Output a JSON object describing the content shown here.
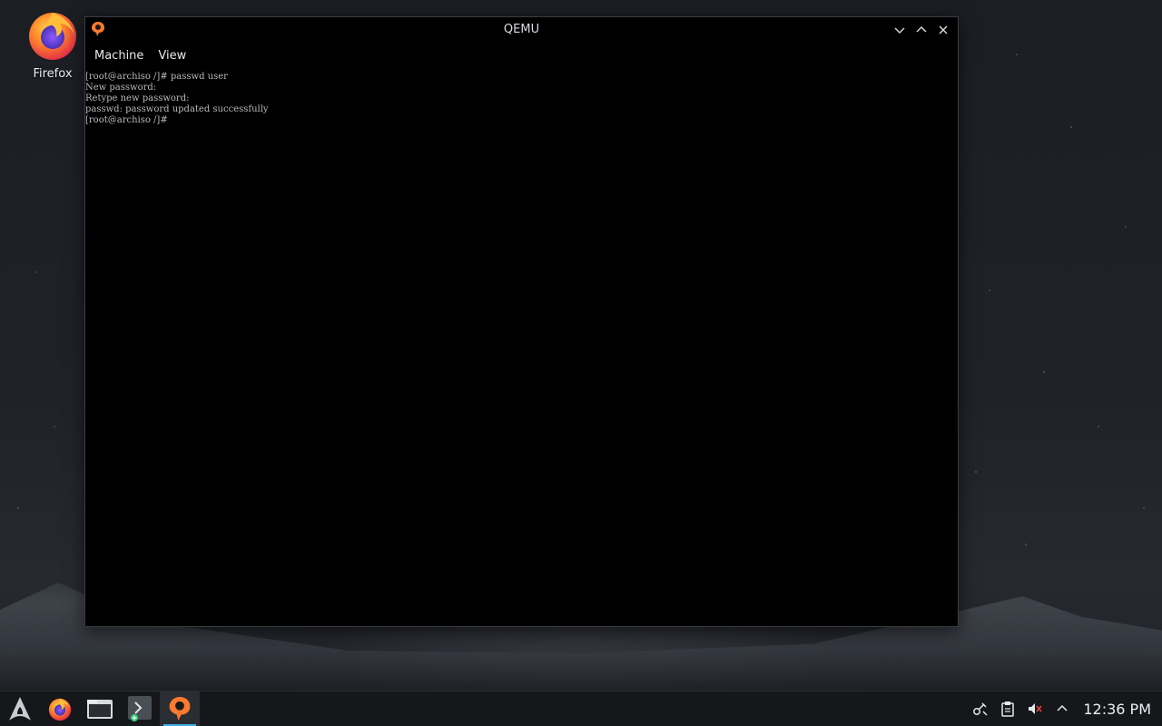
{
  "desktop": {
    "icons": [
      {
        "label": "Firefox",
        "icon": "firefox-icon"
      }
    ]
  },
  "window": {
    "title": "QEMU",
    "app_icon": "qemu-icon",
    "controls": [
      "minimize-icon",
      "maximize-icon",
      "close-icon"
    ],
    "menu": [
      {
        "label": "Machine"
      },
      {
        "label": "View"
      }
    ],
    "console_lines": [
      "[root@archiso /]# passwd user",
      "New password:",
      "Retype new password:",
      "passwd: password updated successfully",
      "[root@archiso /]#"
    ]
  },
  "taskbar": {
    "launcher_icon": "arch-launcher-icon",
    "tasks": [
      {
        "name": "firefox-icon"
      },
      {
        "name": "file-manager-icon"
      },
      {
        "name": "terminal-icon"
      },
      {
        "name": "qemu-icon",
        "active": true
      }
    ],
    "tray": {
      "icons": [
        "network-icon",
        "clipboard-icon",
        "volume-muted-icon",
        "chevron-up-icon"
      ],
      "clock": "12:36 PM"
    }
  },
  "colors": {
    "accent": "#3daee9",
    "firefox_orange": "#ff7139",
    "console_text": "#b8b8b8"
  }
}
